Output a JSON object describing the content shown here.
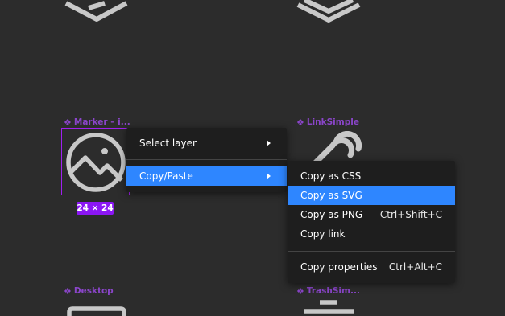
{
  "components": [
    {
      "name": "Marker – i...",
      "icon": "image-icon"
    },
    {
      "name": "LinkSimple",
      "icon": "link-simple-icon"
    },
    {
      "name": "Desktop",
      "icon": "desktop-icon"
    },
    {
      "name": "TrashSim...",
      "icon": "trash-icon"
    }
  ],
  "selection": {
    "size_label": "24 × 24"
  },
  "context_menu": {
    "items": [
      {
        "label": "Select layer",
        "has_submenu": true
      },
      {
        "label": "Copy/Paste",
        "has_submenu": true,
        "active": true
      }
    ]
  },
  "submenu": {
    "items": [
      {
        "label": "Copy as CSS",
        "shortcut": ""
      },
      {
        "label": "Copy as SVG",
        "shortcut": "",
        "active": true
      },
      {
        "label": "Copy as PNG",
        "shortcut": "Ctrl+Shift+C"
      },
      {
        "label": "Copy link",
        "shortcut": ""
      },
      {
        "label": "Copy properties",
        "shortcut": "Ctrl+Alt+C"
      }
    ]
  },
  "colors": {
    "canvas": "#2c2c2c",
    "menu_bg": "#1e1e1e",
    "menu_highlight": "#2e86ff",
    "component_label": "#8a45c9",
    "selection": "#a020f0",
    "icon_stroke": "#c8c8c8"
  }
}
